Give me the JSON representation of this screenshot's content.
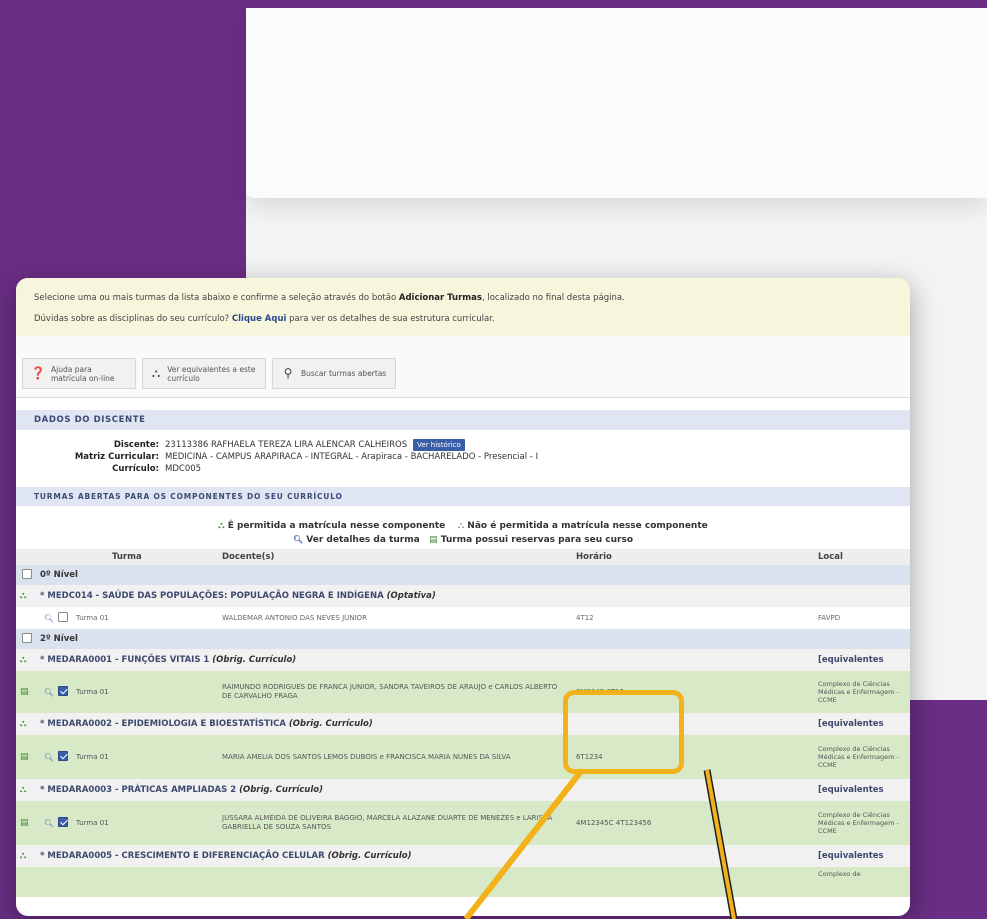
{
  "notice": {
    "line1_pre": "Selecione uma ou mais turmas da lista abaixo e confirme a seleção através do botão ",
    "line1_bold": "Adicionar Turmas",
    "line1_post": ", localizado no final desta página.",
    "line2_pre": "Dúvidas sobre as disciplinas do seu currículo? ",
    "line2_bold": "Clique Aqui",
    "line2_post": " para ver os detalhes de sua estrutura curricular."
  },
  "toolbar": {
    "help": "Ajuda para matrícula on-line",
    "equivalents": "Ver equivalentes a este currículo",
    "search": "Buscar turmas abertas"
  },
  "dados": {
    "header": "Dados do discente",
    "discente_label": "Discente:",
    "discente_value": "23113386 RAFHAELA TEREZA LIRA ALENCAR CALHEIROS",
    "historico_button": "Ver histórico",
    "matriz_label": "Matriz Curricular:",
    "matriz_value": "MEDICINA - CAMPUS ARAPIRACA - INTEGRAL - Arapiraca - BACHARELADO - Presencial - I",
    "curriculo_label": "Currículo:",
    "curriculo_value": "MDC005"
  },
  "turmas": {
    "header": "Turmas abertas para os componentes do seu currículo",
    "legend_permitted": "É permitida a matrícula nesse componente",
    "legend_not_permitted": "Não é permitida a matrícula nesse componente",
    "legend_details": "Ver detalhes da turma",
    "legend_reserves": "Turma possui reservas para seu curso",
    "columns": {
      "turma": "Turma",
      "docentes": "Docente(s)",
      "horario": "Horário",
      "local": "Local"
    },
    "level0": "0º Nível",
    "level2": "2º Nível",
    "rows": {
      "c1_title": "* MEDC014 - SAÚDE DAS POPULAÇÕES: POPULAÇÃO NEGRA E INDÍGENA ",
      "c1_tag": "(Optativa)",
      "t1_turma": "Turma 01",
      "t1_docente": "WALDEMAR ANTONIO DAS NEVES JUNIOR",
      "t1_horario": "4T12",
      "t1_local": "FAVPD",
      "c2_title": "* MEDARA0001 - FUNÇÕES VITAIS 1 ",
      "c2_tag": "(Obrig. Currículo)",
      "c2_eq": "[equivalentes",
      "t2_turma": "Turma 01",
      "t2_docente": "RAIMUNDO RODRIGUES DE FRANCA JUNIOR, SANDRA TAVEIROS DE ARAUJO e CARLOS ALBERTO DE CARVALHO FRAGA",
      "t2_horario": "3M2345 3T12",
      "t2_local": "Complexo de Ciências Médicas e Enfermagem - CCME",
      "c3_title": "* MEDARA0002 - EPIDEMIOLOGIA E BIOESTATÍSTICA ",
      "c3_tag": "(Obrig. Currículo)",
      "c3_eq": "[equivalentes",
      "t3_turma": "Turma 01",
      "t3_docente": "MARIA AMELIA DOS SANTOS LEMOS DUBOIS e FRANCISCA MARIA NUNES DA SILVA",
      "t3_horario": "6T1234",
      "t3_local": "Complexo de Ciências Médicas e Enfermagem - CCME",
      "c4_title": "* MEDARA0003 - PRÁTICAS AMPLIADAS 2 ",
      "c4_tag": "(Obrig. Currículo)",
      "c4_eq": "[equivalentes",
      "t4_turma": "Turma 01",
      "t4_docente": "JUSSARA ALMEIDA DE OLIVEIRA BAGGIO, MARCELA ALAZANE DUARTE DE MENEZES e LARISSA GABRIELLA DE SOUZA SANTOS",
      "t4_horario": "4M12345C 4T123456",
      "t4_local": "Complexo de Ciências Médicas e Enfermagem - CCME",
      "c5_title": "* MEDARA0005 - CRESCIMENTO E DIFERENCIAÇÃO CELULAR ",
      "c5_tag": "(Obrig. Currículo)",
      "c5_eq": "[equivalentes",
      "t5_local": "Complexo de"
    }
  },
  "colors": {
    "background": "#6a2e85",
    "highlight": "#f3b21a",
    "selected_row": "#d8e9c7",
    "section_header": "#dfe5f2"
  }
}
